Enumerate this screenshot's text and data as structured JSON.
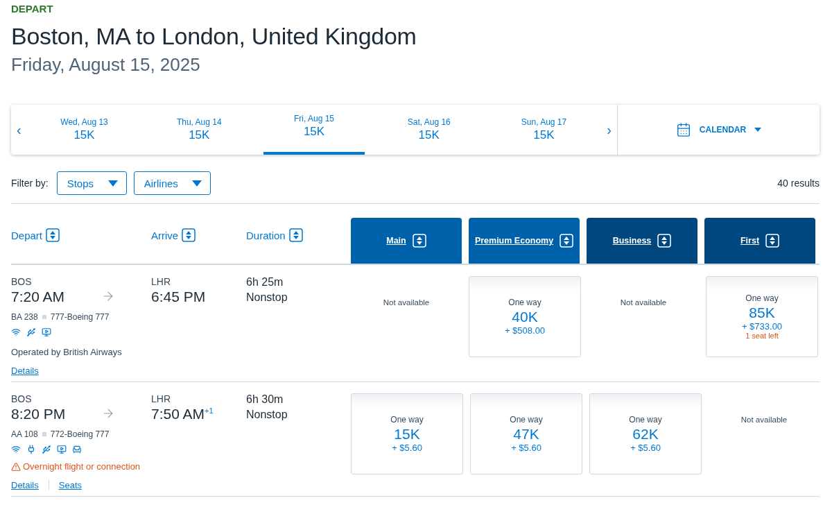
{
  "heading": "DEPART",
  "title": "Boston, MA to London, United Kingdom",
  "date": "Friday, August 15, 2025",
  "date_strip": {
    "prev": "‹",
    "next": "›",
    "calendar": "CALENDAR",
    "days": [
      {
        "label": "Wed, Aug 13",
        "price": "15K",
        "selected": false
      },
      {
        "label": "Thu, Aug 14",
        "price": "15K",
        "selected": false
      },
      {
        "label": "Fri, Aug 15",
        "price": "15K",
        "selected": true
      },
      {
        "label": "Sat, Aug 16",
        "price": "15K",
        "selected": false
      },
      {
        "label": "Sun, Aug 17",
        "price": "15K",
        "selected": false
      }
    ]
  },
  "filters": {
    "label": "Filter by:",
    "dropdowns": [
      "Stops",
      "Airlines"
    ],
    "results": "40 results"
  },
  "columns": [
    "Depart",
    "Arrive",
    "Duration"
  ],
  "cabins": [
    {
      "label": "Main",
      "color": "#0061ab"
    },
    {
      "label": "Premium Economy",
      "color": "#0061ab"
    },
    {
      "label": "Business",
      "color": "#00467f"
    },
    {
      "label": "First",
      "color": "#00467f"
    }
  ],
  "flights": [
    {
      "from": "BOS",
      "depart": "7:20 AM",
      "to": "LHR",
      "arrive": "6:45 PM",
      "duration": "6h 25m",
      "stops": "Nonstop",
      "flight": "BA 238",
      "aircraft": "777-Boeing 777",
      "amenities": [
        {
          "kind": "wifi"
        },
        {
          "kind": "usb"
        },
        {
          "kind": "media"
        }
      ],
      "operated_by": "Operated by British Airways",
      "links": [
        "Details"
      ],
      "fares": [
        {
          "kind": "unavailable",
          "text": "Not available"
        },
        {
          "kind": "available",
          "label": "One way",
          "miles": "40K",
          "tax": "+ $508.00"
        },
        {
          "kind": "unavailable",
          "text": "Not available"
        },
        {
          "kind": "available",
          "label": "One way",
          "miles": "85K",
          "tax": "+ $733.00",
          "note": "1 seat left"
        }
      ]
    },
    {
      "from": "BOS",
      "depart": "8:20 PM",
      "to": "LHR",
      "arrive": "7:50 AM",
      "day_offset": "+1",
      "duration": "6h 30m",
      "stops": "Nonstop",
      "flight": "AA 108",
      "aircraft": "772-Boeing 777",
      "amenities": [
        {
          "kind": "wifi"
        },
        {
          "kind": "power"
        },
        {
          "kind": "usb"
        },
        {
          "kind": "media"
        },
        {
          "kind": "flat"
        }
      ],
      "warning": "Overnight flight or connection",
      "links": [
        "Details",
        "Seats"
      ],
      "fares": [
        {
          "kind": "available",
          "label": "One way",
          "miles": "15K",
          "tax": "+ $5.60"
        },
        {
          "kind": "available",
          "label": "One way",
          "miles": "47K",
          "tax": "+ $5.60"
        },
        {
          "kind": "available",
          "label": "One way",
          "miles": "62K",
          "tax": "+ $5.60"
        },
        {
          "kind": "unavailable",
          "text": "Not available"
        }
      ]
    }
  ]
}
